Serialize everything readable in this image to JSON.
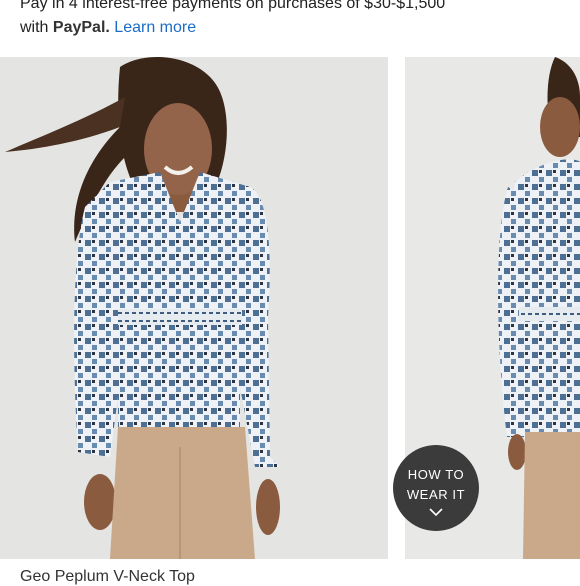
{
  "paypal": {
    "line1": "Pay in 4 interest-free payments on purchases of $30-$1,500",
    "with_text": "with",
    "brand": "PayPal.",
    "learn_more": "Learn more"
  },
  "gallery": {
    "images": [
      {
        "name": "model-front-view"
      },
      {
        "name": "model-side-view"
      }
    ],
    "how_to_wear": {
      "line1": "HOW TO",
      "line2": "WEAR IT",
      "icon": "chevron-down-icon"
    }
  },
  "product": {
    "title_partial": "Geo Peplum V-Neck Top"
  },
  "colors": {
    "link": "#1b6cc9",
    "badge_bg": "#3b3b3b",
    "photo_bg": "#e4e4e3"
  }
}
